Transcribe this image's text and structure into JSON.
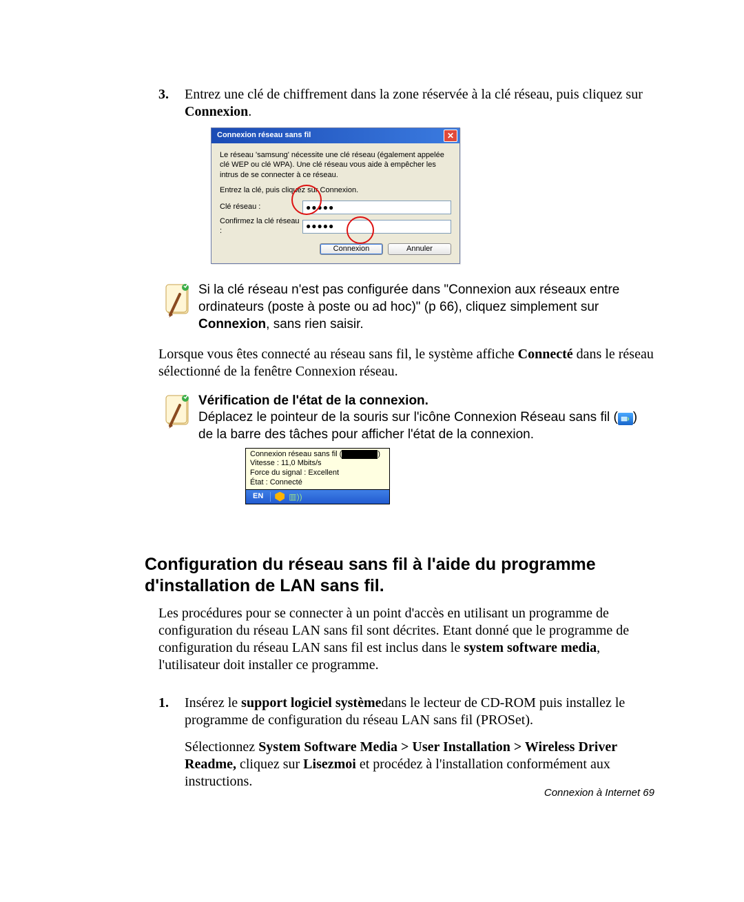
{
  "step3": {
    "marker": "3.",
    "sentence_before": "Entrez une clé de chiffrement dans la zone réservée à la clé réseau, puis cliquez sur ",
    "sentence_bold": "Connexion",
    "sentence_after": "."
  },
  "dialog": {
    "title": "Connexion réseau sans fil",
    "close_glyph": "✕",
    "explain": "Le réseau 'samsung' nécessite une clé réseau (également appelée clé WEP ou clé WPA). Une clé réseau vous aide à empêcher les intrus de se connecter à ce réseau.",
    "prompt": "Entrez la clé, puis cliquez sur Connexion.",
    "key_label": "Clé réseau :",
    "confirm_label": "Confirmez la clé réseau :",
    "dots": "●●●●●",
    "btn_connect": "Connexion",
    "btn_cancel": "Annuler"
  },
  "note1": {
    "line1": "Si la clé réseau n'est pas configurée dans \"Connexion aux réseaux entre ordinateurs (poste à poste ou ad hoc)\" (p 66), cliquez simplement sur ",
    "bold": "Connexion",
    "line2": ", sans rien saisir."
  },
  "middle_para": {
    "t1": "Lorsque vous êtes connecté au réseau sans fil, le système affiche ",
    "bold": "Connecté",
    "t2": " dans le réseau sélectionné de la fenêtre Connexion réseau."
  },
  "note2": {
    "heading": "Vérification de l'état de la connexion.",
    "text_before": "Déplacez le pointeur de la souris sur l'icône Connexion Réseau sans fil (",
    "text_after": ") de la barre des tâches pour afficher l'état de la connexion."
  },
  "tooltip": {
    "l1_prefix": "Connexion réseau sans fil (",
    "l1_masked": "XXXXXX",
    "l1_suffix": ")",
    "l2": "Vitesse : 11,0 Mbits/s",
    "l3": "Force du signal : Excellent",
    "l4": "État : Connecté",
    "lang": "EN"
  },
  "section_heading": "Configuration du réseau sans fil à l'aide du programme d'installation de LAN sans fil.",
  "intro": {
    "t1": "Les procédures pour se connecter à un point d'accès en utilisant un programme de configuration du réseau LAN sans fil sont décrites. Etant donné que le programme de configuration du réseau LAN sans fil est inclus dans le ",
    "bold": "system software media",
    "t2": ", l'utilisateur doit installer ce programme."
  },
  "step1": {
    "marker": "1.",
    "t1": "Insérez le ",
    "bold1": "support logiciel système",
    "t2": "dans le lecteur de CD-ROM puis installez le programme de configuration du réseau LAN sans fil (PROSet).",
    "t3": "Sélectionnez ",
    "bold2": "System Software Media > User Installation > Wireless Driver Readme, ",
    "t4": "cliquez sur ",
    "bold3": "Lisezmoi",
    "t5": " et procédez à l'installation conformément aux instructions."
  },
  "footer": "Connexion à Internet  69"
}
